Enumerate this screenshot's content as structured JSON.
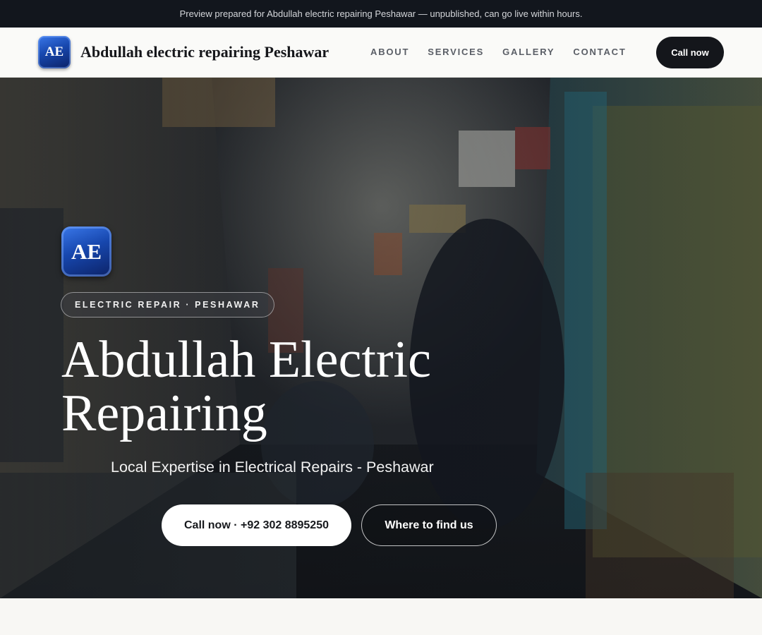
{
  "preview_banner": "Preview prepared for Abdullah electric repairing Peshawar — unpublished, can go live within hours.",
  "header": {
    "logo_text": "AE",
    "brand": "Abdullah electric repairing Peshawar",
    "nav": [
      "ABOUT",
      "SERVICES",
      "GALLERY",
      "CONTACT"
    ],
    "call_button": "Call now"
  },
  "hero": {
    "logo_text": "AE",
    "tagline": "ELECTRIC REPAIR · PESHAWAR",
    "title_line1": "Abdullah Electric",
    "title_line2": "Repairing",
    "subtitle": "Local Expertise in Electrical Repairs - Peshawar",
    "primary_button": "Call now · +92 302 8895250",
    "secondary_button": "Where to find us",
    "background_image": "shop-alley-photo"
  },
  "colors": {
    "dark": "#12161d",
    "brand_blue": "#1747ae",
    "light_bg": "#fafaf8"
  }
}
